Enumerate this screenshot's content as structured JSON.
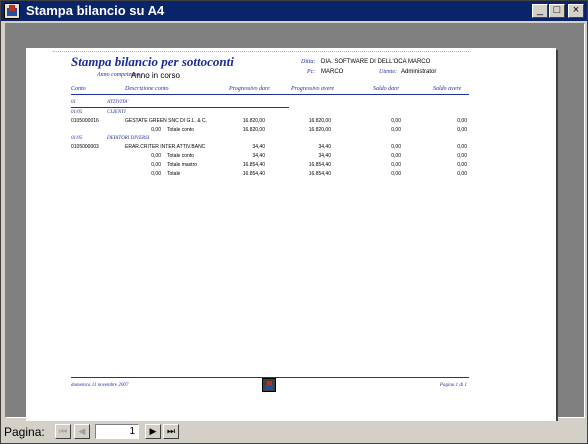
{
  "window": {
    "title": "Stampa bilancio su A4",
    "min_label": "_",
    "max_label": "□",
    "close_label": "×"
  },
  "report": {
    "title": "Stampa bilancio per sottoconti",
    "ditta_label": "Ditta:",
    "ditta_value": "DIA. SOFTWARE DI DELL'OCA MARCO",
    "pc_label": "Pc:",
    "pc_value": "MARCO",
    "utente_label": "Utente:",
    "utente_value": "Administrator",
    "year_label": "Anno competenza :",
    "year_value": "Anno in corso",
    "columns": [
      "Conto",
      "Descrizione conto",
      "Progressivo dare",
      "Progressivo avere",
      "Saldo dare",
      "Saldo avere"
    ],
    "groups": [
      {
        "code": "01",
        "label": "ATTIVITA'"
      },
      {
        "code": "01/05",
        "label": "CLIENTI"
      },
      {
        "code": "01/05",
        "label": "DEBITORI DIVERSI"
      }
    ],
    "rows": [
      {
        "code": "0105000016",
        "desc": "GESTATE GREEN SNC DI G.L. & C.",
        "pdare": "16.820,00",
        "pavere": "16.820,00",
        "sdare": "0,00",
        "savere": "0,00"
      },
      {
        "amt": "0,00",
        "desc": "Totale conto",
        "pdare": "16.820,00",
        "pavere": "16.820,00",
        "sdare": "0,00",
        "savere": "0,00"
      },
      {
        "code": "0105000003",
        "desc": "ERAR.CRITER INTER.ATTIV.BANC",
        "pdare": "34,40",
        "pavere": "34,40",
        "sdare": "0,00",
        "savere": "0,00"
      },
      {
        "amt": "0,00",
        "desc": "Totale conto",
        "pdare": "34,40",
        "pavere": "34,40",
        "sdare": "0,00",
        "savere": "0,00"
      },
      {
        "amt": "0,00",
        "desc": "Totale mastro",
        "pdare": "16.854,40",
        "pavere": "16.854,40",
        "sdare": "0,00",
        "savere": "0,00"
      },
      {
        "amt": "0,00",
        "desc": "Totale",
        "pdare": "16.854,40",
        "pavere": "16.854,40",
        "sdare": "0,00",
        "savere": "0,00"
      }
    ],
    "footer_date": "domenica 11 novembre 2007",
    "footer_page": "Pagina 1 di 1"
  },
  "navigation": {
    "label": "Pagina:",
    "current_page": "1",
    "first": "⏮",
    "prev": "◀",
    "next": "▶",
    "last": "⏭"
  }
}
